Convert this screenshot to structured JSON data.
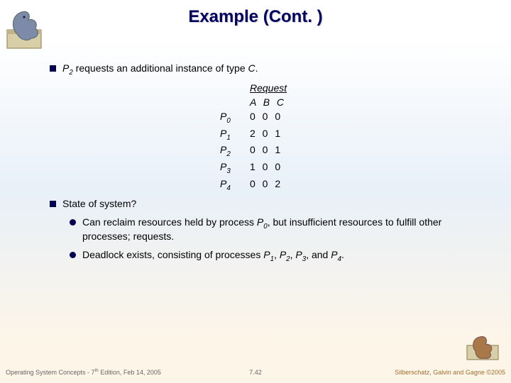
{
  "title": "Example (Cont. )",
  "bullets": {
    "b1_pre": "P",
    "b1_sub": "2",
    "b1_post": " requests an additional instance of type ",
    "b1_c": "C",
    "b1_end": ".",
    "req_title": "Request",
    "req_hdr": "A B C",
    "rows": [
      {
        "p": "P",
        "s": "0",
        "v": "0 0 0"
      },
      {
        "p": "P",
        "s": "1",
        "v": "2 0 1"
      },
      {
        "p": "P",
        "s": "2",
        "v": "0 0 1"
      },
      {
        "p": "P",
        "s": "3",
        "v": "1 0 0"
      },
      {
        "p": "P",
        "s": "4",
        "v": "0 0 2"
      }
    ],
    "b2": "State of system?",
    "b3_pre": "Can reclaim resources held by process ",
    "b3_p": "P",
    "b3_s": "0",
    "b3_post": ", but insufficient resources to fulfill other processes; requests.",
    "b4_pre": "Deadlock exists, consisting of processes ",
    "b4_p1": "P",
    "b4_s1": "1",
    "b4_c1": ", ",
    "b4_p2": "P",
    "b4_s2": "2",
    "b4_c2": ", ",
    "b4_p3": "P",
    "b4_s3": "3",
    "b4_c3": ", and ",
    "b4_p4": "P",
    "b4_s4": "4",
    "b4_end": "."
  },
  "footer": {
    "left_pre": "Operating System Concepts - 7",
    "left_sup": "th",
    "left_post": " Edition, Feb 14, 2005",
    "center": "7.42",
    "right": "Silberschatz, Galvin and Gagne ©2005"
  }
}
